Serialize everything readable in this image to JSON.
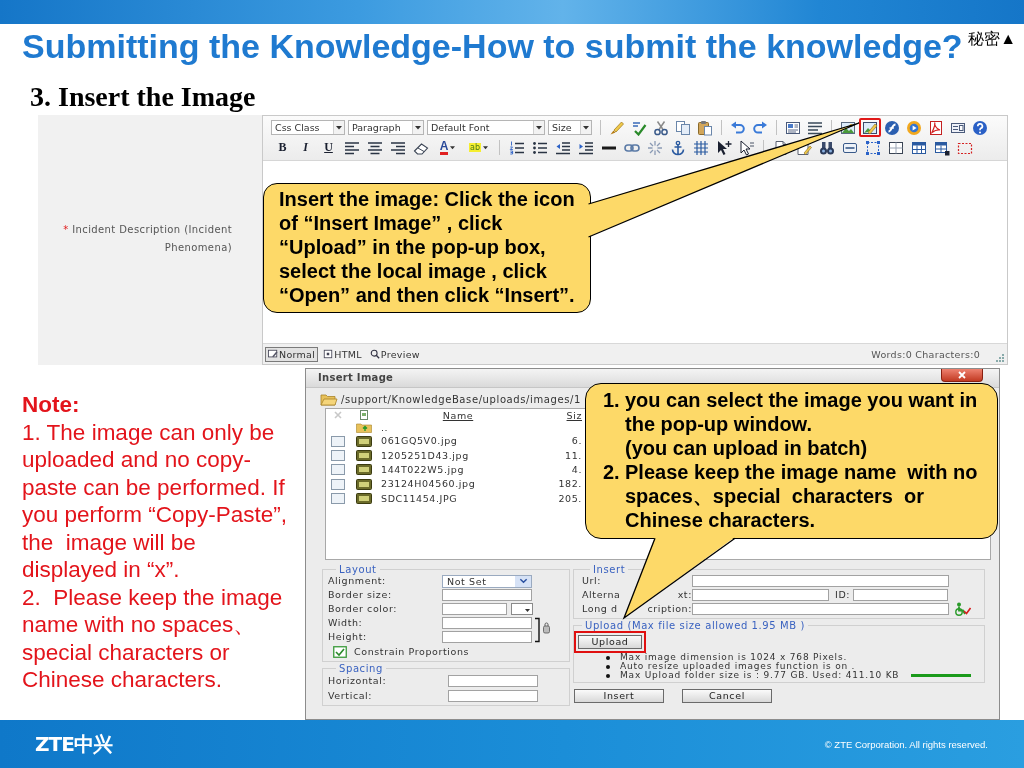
{
  "header": {
    "title": "Submitting the Knowledge-How to submit the knowledge?",
    "classification": "秘密▲"
  },
  "step_heading": "3. Insert the Image",
  "editor": {
    "required_mark": "*",
    "field_label": "Incident Description (Incident Phenomena)",
    "selects": [
      "Css Class",
      "Paragraph",
      "Default Font",
      "Size"
    ],
    "toolbar_rows": [
      [
        [
          {
            "kind": "brush",
            "highlighted": false
          },
          {
            "kind": "spellcheck",
            "highlighted": false
          },
          {
            "kind": "cut",
            "highlighted": false
          },
          {
            "kind": "copy",
            "highlighted": false
          },
          {
            "kind": "paste",
            "highlighted": false
          }
        ],
        [
          {
            "kind": "undo",
            "highlighted": false
          },
          {
            "kind": "redo",
            "highlighted": false
          }
        ],
        [
          {
            "kind": "template",
            "highlighted": false
          },
          {
            "kind": "paragraph",
            "highlighted": false
          }
        ],
        [
          {
            "kind": "image",
            "highlighted": false
          },
          {
            "kind": "insert-image",
            "highlighted": true
          },
          {
            "kind": "flash",
            "highlighted": false
          },
          {
            "kind": "media",
            "highlighted": false
          },
          {
            "kind": "pdf",
            "highlighted": false
          },
          {
            "kind": "form",
            "highlighted": false
          },
          {
            "kind": "help",
            "highlighted": false
          }
        ]
      ],
      [
        [
          {
            "kind": "bold",
            "label": "B",
            "highlighted": false
          },
          {
            "kind": "italic",
            "label": "I",
            "highlighted": false
          },
          {
            "kind": "underline",
            "label": "U",
            "highlighted": false
          },
          {
            "kind": "align-left",
            "highlighted": false
          },
          {
            "kind": "align-center",
            "highlighted": false
          },
          {
            "kind": "align-right",
            "highlighted": false
          },
          {
            "kind": "eraser",
            "highlighted": false
          },
          {
            "kind": "font-color",
            "label": "A",
            "highlighted": false
          },
          {
            "kind": "highlight",
            "label": "ab",
            "highlighted": false
          }
        ],
        [
          {
            "kind": "ordered-list",
            "highlighted": false
          },
          {
            "kind": "bullet-list",
            "highlighted": false
          },
          {
            "kind": "outdent",
            "highlighted": false
          },
          {
            "kind": "indent",
            "highlighted": false
          },
          {
            "kind": "rule",
            "highlighted": false
          },
          {
            "kind": "link",
            "highlighted": false
          },
          {
            "kind": "unlink",
            "highlighted": false
          },
          {
            "kind": "anchor",
            "highlighted": false
          },
          {
            "kind": "table-grid",
            "highlighted": false
          },
          {
            "kind": "cursor-plus",
            "highlighted": false
          },
          {
            "kind": "cursor",
            "highlighted": false
          }
        ],
        [
          {
            "kind": "new-doc",
            "highlighted": false
          },
          {
            "kind": "doc-edit",
            "highlighted": false
          },
          {
            "kind": "binoculars",
            "highlighted": false
          },
          {
            "kind": "card",
            "highlighted": false
          },
          {
            "kind": "frame",
            "highlighted": false
          },
          {
            "kind": "cell",
            "highlighted": false
          },
          {
            "kind": "table",
            "highlighted": false
          },
          {
            "kind": "table-add",
            "highlighted": false
          },
          {
            "kind": "dashed-box",
            "highlighted": false
          }
        ]
      ]
    ],
    "modes": [
      {
        "kind": "design",
        "label": "Normal",
        "selected": true
      },
      {
        "kind": "html",
        "label": "HTML",
        "selected": false
      },
      {
        "kind": "preview",
        "label": "Preview",
        "selected": false
      }
    ],
    "word_count": "Words:0 Characters:0"
  },
  "callout_toolbar": {
    "text": "Insert the image: Click the icon of “Insert Image” , click “Upload” in the pop-up box, select the local image , click “Open” and then click “Insert”."
  },
  "note": {
    "title": "Note:",
    "paragraphs": [
      "1. The image can only be uploaded and no copy-paste can be performed. If you perform “Copy-Paste”, the  image will be displayed in “x”.",
      "2.  Please keep the image name with no spaces、special characters or Chinese characters."
    ]
  },
  "dialog": {
    "title": "Insert Image",
    "path": "/support/KnowledgeBase/uploads/images/1",
    "columns": [
      "Name",
      "Siz"
    ],
    "parent_entry": "..",
    "files": [
      {
        "name": "061GQ5V0.jpg",
        "size": "6.",
        "checked": false
      },
      {
        "name": "1205251D43.jpg",
        "size": "11.",
        "checked": false
      },
      {
        "name": "144T022W5.jpg",
        "size": "4.",
        "checked": false
      },
      {
        "name": "23124H04560.jpg",
        "size": "182.",
        "checked": false
      },
      {
        "name": "SDC11454.JPG",
        "size": "205.",
        "checked": false
      }
    ],
    "layout": {
      "legend": "Layout",
      "fields": [
        {
          "kind": "select",
          "label": "Alignment:",
          "value": "Not Set"
        },
        {
          "kind": "input",
          "label": "Border size:"
        },
        {
          "kind": "color",
          "label": "Border color:"
        }
      ],
      "size_fields": [
        {
          "label": "Width:"
        },
        {
          "label": "Height:"
        }
      ],
      "constrain": {
        "label": "Constrain Proportions",
        "checked": true
      }
    },
    "spacing": {
      "legend": "Spacing",
      "fields": [
        {
          "label": "Horizontal:"
        },
        {
          "label": "Vertical:"
        }
      ]
    },
    "insert": {
      "legend": "Insert",
      "url_label": "Url:",
      "alt_label_start": "Alterna",
      "alt_label_end": "xt:",
      "id_label": "ID:",
      "long_label_start": "Long d",
      "long_label_end": "cription:"
    },
    "upload": {
      "legend": "Upload (Max file size allowed 1.95 MB )",
      "button": "Upload",
      "highlighted": true,
      "notes": [
        "Max image dimension is 1024 x 768 Pixels.",
        "Auto resize uploaded images function is on .",
        "Max Upload folder size is : 9.77 GB. Used: 411.10 KB"
      ]
    },
    "buttons": [
      "Insert",
      "Cancel"
    ]
  },
  "callout_dialog": {
    "items": [
      {
        "number": "1.",
        "text": "you can select the image you want in the pop-up window.",
        "note": "(you can upload in batch)"
      },
      {
        "number": "2.",
        "text": "Please keep the image name  with no spaces、special  characters  or Chinese characters."
      }
    ]
  },
  "footer": {
    "logo": "ZTE中兴",
    "copyright": "© ZTE Corporation. All rights reserved."
  }
}
